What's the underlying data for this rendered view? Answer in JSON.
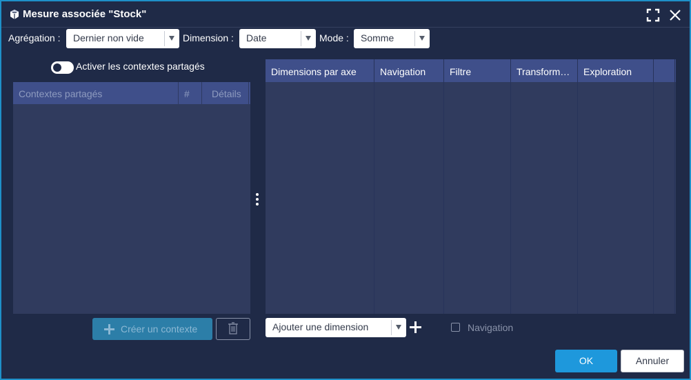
{
  "window": {
    "title": "Mesure associée \"Stock\"",
    "logo_icon": "cube-logo-icon",
    "maximize_icon": "maximize-icon",
    "close_icon": "close-icon"
  },
  "toolbar": {
    "aggregation_label": "Agrégation :",
    "aggregation_value": "Dernier non vide",
    "dimension_label": "Dimension :",
    "dimension_value": "Date",
    "mode_label": "Mode :",
    "mode_value": "Somme"
  },
  "shared_contexts": {
    "toggle_label": "Activer les contextes partagés",
    "toggle_on": false,
    "columns": [
      "Contextes partagés",
      "#",
      "Détails"
    ],
    "rows": [],
    "create_button": "Créer un contexte",
    "delete_icon": "trash-icon"
  },
  "dimensions": {
    "columns": [
      "Dimensions par axe",
      "Navigation",
      "Filtre",
      "Transform…",
      "Exploration",
      ""
    ],
    "rows": [],
    "add_placeholder": "Ajouter une dimension",
    "add_icon": "plus-icon",
    "navigation_checkbox_label": "Navigation",
    "navigation_checked": false
  },
  "footer": {
    "ok_label": "OK",
    "cancel_label": "Annuler"
  },
  "colors": {
    "background": "#1f2a47",
    "panel": "#303b5e",
    "header": "#3f4f8a",
    "accent": "#1e98dc",
    "border": "#1e90c8"
  }
}
